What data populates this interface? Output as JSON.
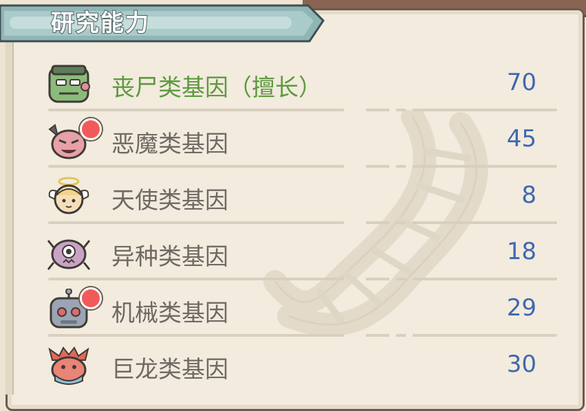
{
  "panel": {
    "title": "研究能力"
  },
  "genes": [
    {
      "icon": "zombie-icon",
      "label": "丧尸类基因（擅长）",
      "value": "70",
      "specialty": true,
      "has_alert": false
    },
    {
      "icon": "demon-icon",
      "label": "恶魔类基因",
      "value": "45",
      "specialty": false,
      "has_alert": true
    },
    {
      "icon": "angel-icon",
      "label": "天使类基因",
      "value": "8",
      "specialty": false,
      "has_alert": false
    },
    {
      "icon": "alien-icon",
      "label": "异种类基因",
      "value": "18",
      "specialty": false,
      "has_alert": false
    },
    {
      "icon": "robot-icon",
      "label": "机械类基因",
      "value": "29",
      "specialty": false,
      "has_alert": true
    },
    {
      "icon": "dragon-icon",
      "label": "巨龙类基因",
      "value": "30",
      "specialty": false,
      "has_alert": false
    }
  ],
  "colors": {
    "specialty_label": "#5d9a3e",
    "label": "#6e6a63",
    "value": "#3f68b0",
    "alert_badge": "#f25a5a"
  }
}
